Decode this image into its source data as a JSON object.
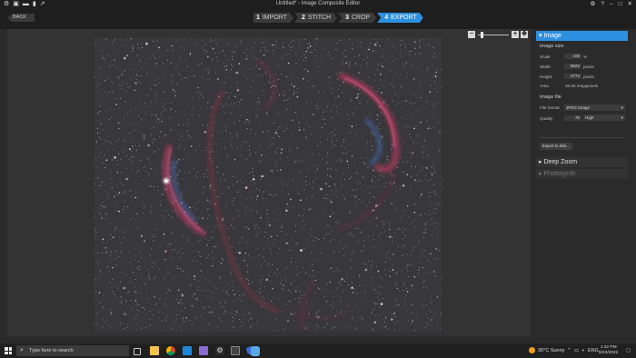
{
  "window": {
    "title": "Untitled* - Image Composite Editor",
    "left_icons": [
      "gear-icon",
      "new-project-icon",
      "open-icon",
      "save-icon",
      "share-icon"
    ],
    "right_icons": [
      "settings-icon",
      "help-icon",
      "minimize-icon",
      "maximize-icon",
      "close-icon"
    ]
  },
  "nav": {
    "back_label": "BACK",
    "steps": [
      {
        "num": "1",
        "label": "IMPORT",
        "active": false
      },
      {
        "num": "2",
        "label": "STITCH",
        "active": false
      },
      {
        "num": "3",
        "label": "CROP",
        "active": false
      },
      {
        "num": "4",
        "label": "EXPORT",
        "active": true
      }
    ]
  },
  "zoom": {
    "level_fraction": 0.12
  },
  "panel": {
    "image_header": "Image",
    "image_size_label": "Image size",
    "scale_label": "Scale",
    "scale_value": "100",
    "scale_unit": "%",
    "width_label": "Width",
    "width_value": "5624",
    "width_unit": "pixels",
    "height_label": "Height",
    "height_value": "4774",
    "height_unit": "pixels",
    "area_label": "Area",
    "area_value": "26.85 megapixels",
    "image_file_label": "Image file",
    "format_label": "File format",
    "format_value": "JPEG Image",
    "quality_label": "Quality",
    "quality_value": "75",
    "quality_preset": "High",
    "export_button": "Export to disk...",
    "deepzoom_header": "Deep Zoom",
    "photosynth_header": "Photosynth"
  },
  "taskbar": {
    "search_placeholder": "Type here to search",
    "apps": [
      "task-view-icon",
      "file-explorer-icon",
      "chrome-icon",
      "vscode-icon",
      "photos-icon",
      "settings-app-icon",
      "terminal-icon",
      "shield-app-icon",
      "ice-app-icon"
    ],
    "weather_temp": "30°C",
    "weather_desc": "Sunny",
    "language": "ENG",
    "time": "1:32 PM",
    "date": "8/23/2022"
  }
}
